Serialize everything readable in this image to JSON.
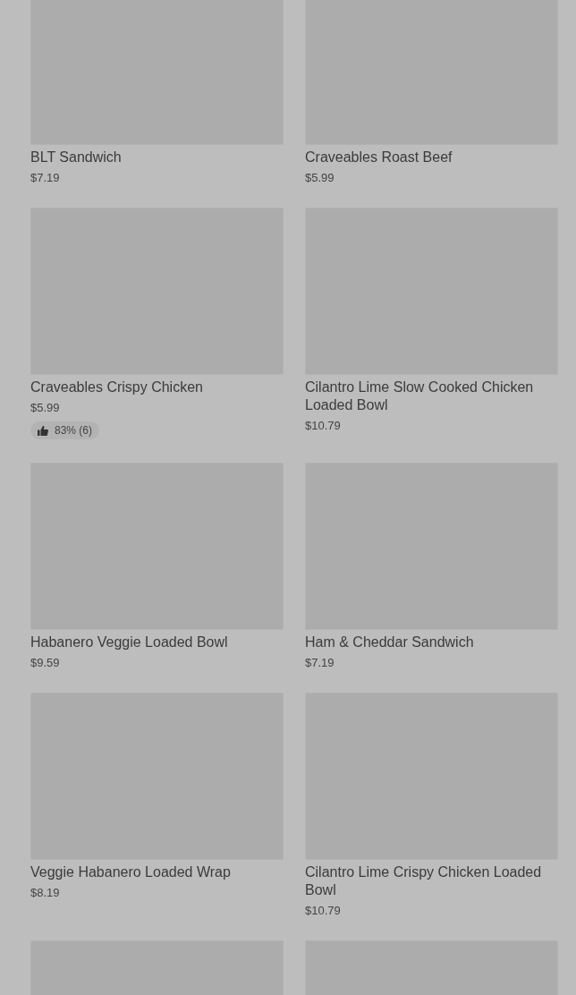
{
  "items": [
    {
      "kind": "product",
      "name": "BLT Sandwich",
      "price": "$7.19"
    },
    {
      "kind": "product",
      "name": "Craveables Roast Beef",
      "price": "$5.99"
    },
    {
      "kind": "product",
      "name": "Craveables Crispy Chicken",
      "price": "$5.99",
      "rating": "83% (6)"
    },
    {
      "kind": "product",
      "name": "Cilantro Lime Slow Cooked Chicken Loaded Bowl",
      "price": "$10.79"
    },
    {
      "kind": "product",
      "name": "Habanero Veggie Loaded Bowl",
      "price": "$9.59"
    },
    {
      "kind": "product",
      "name": "Ham & Cheddar Sandwich",
      "price": "$7.19"
    },
    {
      "kind": "product",
      "name": "Veggie Habanero Loaded Wrap",
      "price": "$8.19"
    },
    {
      "kind": "product",
      "name": "Cilantro Lime Crispy Chicken Loaded Bowl",
      "price": "$10.79"
    },
    {
      "kind": "image-only"
    },
    {
      "kind": "image-only"
    }
  ]
}
